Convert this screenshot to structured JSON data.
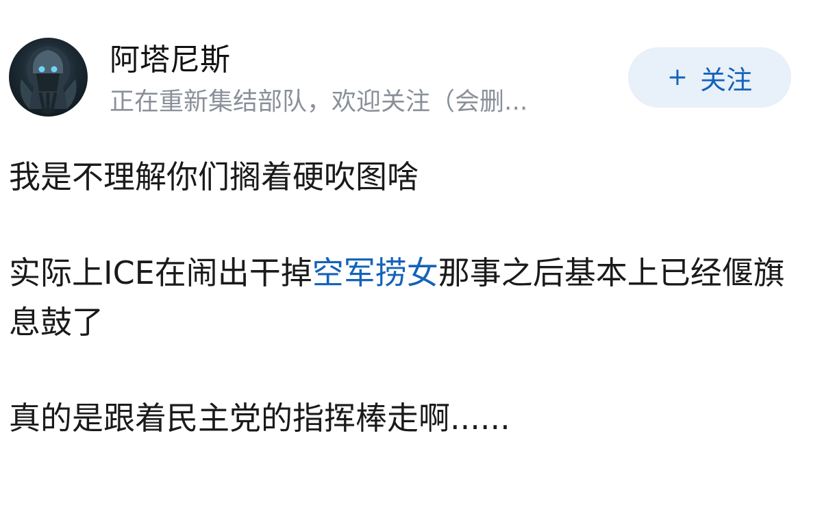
{
  "author": {
    "name": "阿塔尼斯",
    "bio": "正在重新集结部队，欢迎关注（会删..."
  },
  "follow_button": {
    "plus": "+",
    "label": "关注"
  },
  "post": {
    "p1": "我是不理解你们搁着硬吹图啥",
    "p2_before": "实际上ICE在闹出干掉",
    "p2_link": "空军捞女",
    "p2_after": "那事之后基本上已经偃旗息鼓了",
    "p3": "真的是跟着民主党的指挥棒走啊......"
  },
  "colors": {
    "link": "#1463b8",
    "follow_bg": "#e8f0fa",
    "bio_gray": "#8a909a"
  }
}
